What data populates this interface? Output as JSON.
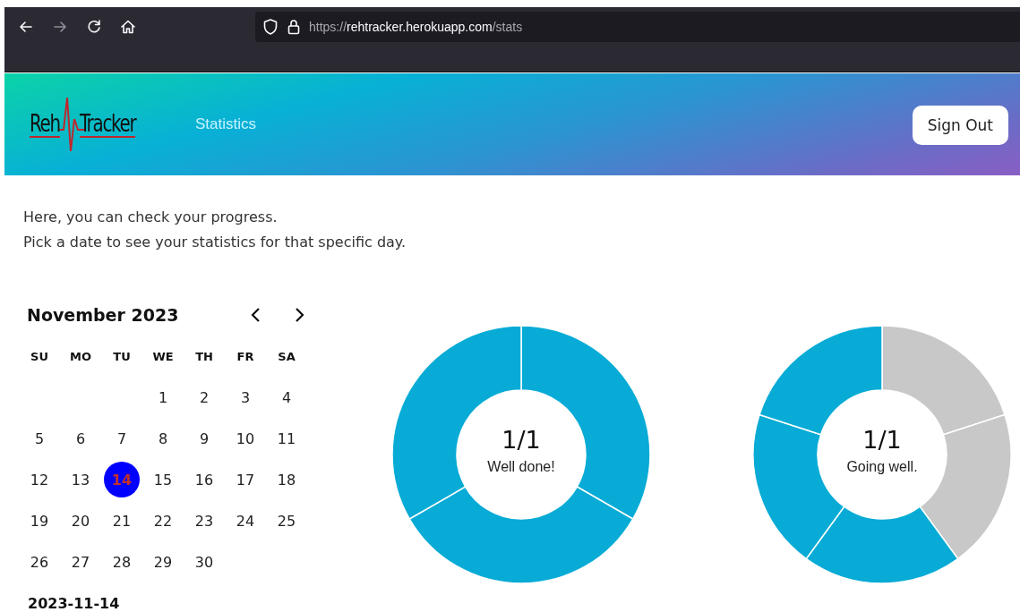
{
  "browser": {
    "back_disabled": false,
    "forward_disabled": true,
    "url": {
      "scheme": "https://",
      "host": "rehtracker.herokuapp.com",
      "path": "/stats"
    }
  },
  "header": {
    "logo": {
      "left": "Reh",
      "right": "Tracker"
    },
    "nav": [
      {
        "label": "Statistics",
        "selected": true
      }
    ],
    "sign_out": "Sign Out"
  },
  "intro": [
    "Here, you can check your progress.",
    "Pick a date to see your statistics for that specific day."
  ],
  "calendar": {
    "title": "November 2023",
    "weekdays": [
      "SU",
      "MO",
      "TU",
      "WE",
      "TH",
      "FR",
      "SA"
    ],
    "weeks": [
      [
        {
          "kind": "empty"
        },
        {
          "kind": "empty"
        },
        {
          "kind": "empty"
        },
        {
          "kind": "day",
          "label": "1",
          "selected": false
        },
        {
          "kind": "day",
          "label": "2",
          "selected": false
        },
        {
          "kind": "day",
          "label": "3",
          "selected": false
        },
        {
          "kind": "day",
          "label": "4",
          "selected": false
        }
      ],
      [
        {
          "kind": "day",
          "label": "5",
          "selected": false
        },
        {
          "kind": "day",
          "label": "6",
          "selected": false
        },
        {
          "kind": "day",
          "label": "7",
          "selected": false
        },
        {
          "kind": "day",
          "label": "8",
          "selected": false
        },
        {
          "kind": "day",
          "label": "9",
          "selected": false
        },
        {
          "kind": "day",
          "label": "10",
          "selected": false
        },
        {
          "kind": "day",
          "label": "11",
          "selected": false
        }
      ],
      [
        {
          "kind": "day",
          "label": "12",
          "selected": false
        },
        {
          "kind": "day",
          "label": "13",
          "selected": false
        },
        {
          "kind": "day",
          "label": "14",
          "selected": true
        },
        {
          "kind": "day",
          "label": "15",
          "selected": false
        },
        {
          "kind": "day",
          "label": "16",
          "selected": false
        },
        {
          "kind": "day",
          "label": "17",
          "selected": false
        },
        {
          "kind": "day",
          "label": "18",
          "selected": false
        }
      ],
      [
        {
          "kind": "day",
          "label": "19",
          "selected": false
        },
        {
          "kind": "day",
          "label": "20",
          "selected": false
        },
        {
          "kind": "day",
          "label": "21",
          "selected": false
        },
        {
          "kind": "day",
          "label": "22",
          "selected": false
        },
        {
          "kind": "day",
          "label": "23",
          "selected": false
        },
        {
          "kind": "day",
          "label": "24",
          "selected": false
        },
        {
          "kind": "day",
          "label": "25",
          "selected": false
        }
      ],
      [
        {
          "kind": "day",
          "label": "26",
          "selected": false
        },
        {
          "kind": "day",
          "label": "27",
          "selected": false
        },
        {
          "kind": "day",
          "label": "28",
          "selected": false
        },
        {
          "kind": "day",
          "label": "29",
          "selected": false
        },
        {
          "kind": "day",
          "label": "30",
          "selected": false
        }
      ]
    ],
    "selected_date": "2023-11-14"
  },
  "progress": [
    {
      "count": "1/1",
      "message": "Well done!",
      "segments": [
        {
          "filled": true
        },
        {
          "filled": true
        },
        {
          "filled": true
        }
      ]
    },
    {
      "count": "1/1",
      "message": "Going well.",
      "segments": [
        {
          "filled": false
        },
        {
          "filled": false
        },
        {
          "filled": true
        },
        {
          "filled": true
        },
        {
          "filled": true
        }
      ]
    }
  ]
}
